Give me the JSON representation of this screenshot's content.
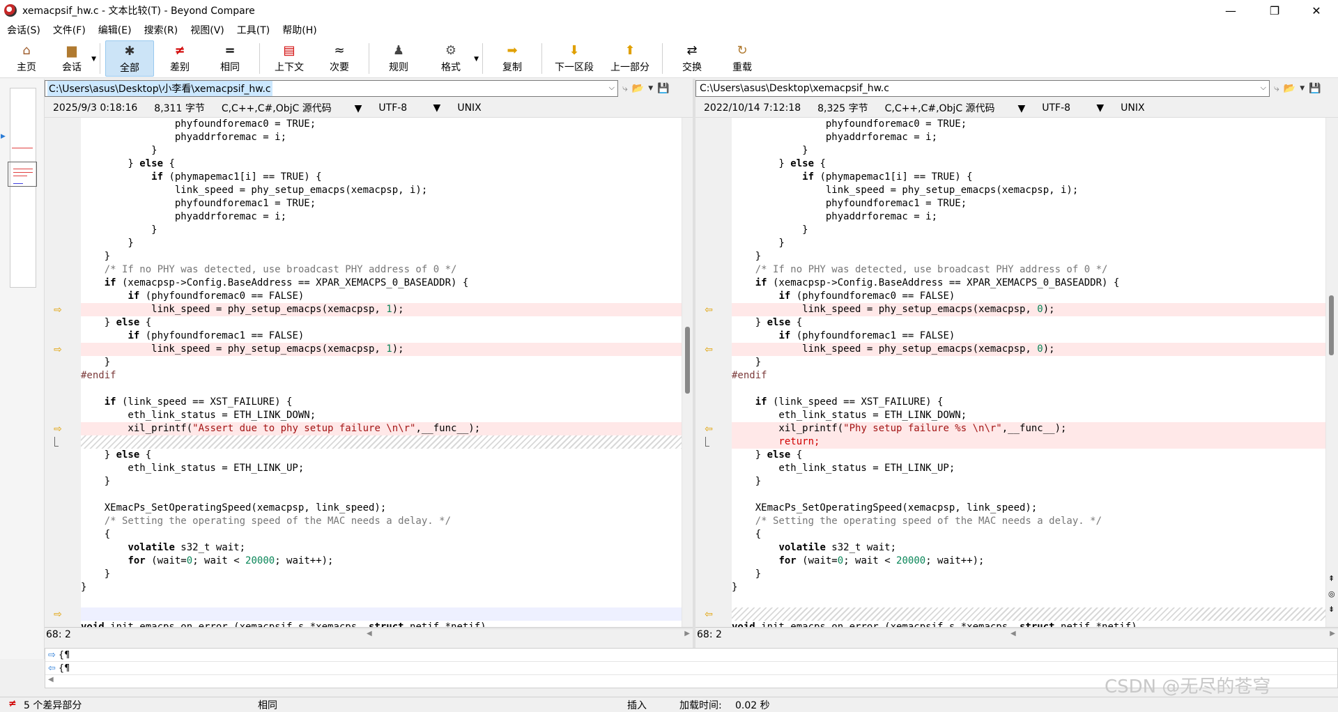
{
  "window": {
    "title": "xemacpsif_hw.c - 文本比较(T) - Beyond Compare",
    "minimize": "—",
    "maximize": "❐",
    "close": "✕"
  },
  "menu": [
    "会话(S)",
    "文件(F)",
    "编辑(E)",
    "搜索(R)",
    "视图(V)",
    "工具(T)",
    "帮助(H)"
  ],
  "toolbar": {
    "home": "主页",
    "session": "会话",
    "all": "全部",
    "diffs": "差别",
    "same": "相同",
    "context": "上下文",
    "minor": "次要",
    "rules": "规则",
    "format": "格式",
    "copy": "复制",
    "next_section": "下一区段",
    "prev_section": "上一部分",
    "swap": "交换",
    "reload": "重载"
  },
  "left": {
    "path": "C:\\Users\\asus\\Desktop\\小李看\\xemacpsif_hw.c",
    "date": "2025/9/3 0:18:16",
    "size": "8,311 字节",
    "format": "C,C++,C#,ObjC 源代码",
    "encoding": "UTF-8",
    "lineend": "UNIX",
    "position": "68: 2",
    "lines": [
      "                phyfoundforemac0 = TRUE;",
      "                phyaddrforemac = i;",
      "            }",
      "        } else {",
      "            if (phymapemac1[i] == TRUE) {",
      "                link_speed = phy_setup_emacps(xemacpsp, i);",
      "                phyfoundforemac1 = TRUE;",
      "                phyaddrforemac = i;",
      "            }",
      "        }",
      "    }",
      "    /* If no PHY was detected, use broadcast PHY address of 0 */",
      "    if (xemacpsp->Config.BaseAddress == XPAR_XEMACPS_0_BASEADDR) {",
      "        if (phyfoundforemac0 == FALSE)",
      "            link_speed = phy_setup_emacps(xemacpsp, 1);",
      "    } else {",
      "        if (phyfoundforemac1 == FALSE)",
      "            link_speed = phy_setup_emacps(xemacpsp, 1);",
      "    }",
      "#endif",
      "",
      "    if (link_speed == XST_FAILURE) {",
      "        eth_link_status = ETH_LINK_DOWN;",
      "        xil_printf(\"Assert due to phy setup failure \\n\\r\",__func__);",
      "",
      "    } else {",
      "        eth_link_status = ETH_LINK_UP;",
      "    }",
      "",
      "    XEmacPs_SetOperatingSpeed(xemacpsp, link_speed);",
      "    /* Setting the operating speed of the MAC needs a delay. */",
      "    {",
      "        volatile s32_t wait;",
      "        for (wait=0; wait < 20000; wait++);",
      "    }",
      "}",
      "",
      "",
      "void init_emacps_on_error (xemacpsif_s *xemacps, struct netif *netif)"
    ]
  },
  "right": {
    "path": "C:\\Users\\asus\\Desktop\\xemacpsif_hw.c",
    "date": "2022/10/14 7:12:18",
    "size": "8,325 字节",
    "format": "C,C++,C#,ObjC 源代码",
    "encoding": "UTF-8",
    "lineend": "UNIX",
    "position": "68: 2",
    "lines": [
      "                phyfoundforemac0 = TRUE;",
      "                phyaddrforemac = i;",
      "            }",
      "        } else {",
      "            if (phymapemac1[i] == TRUE) {",
      "                link_speed = phy_setup_emacps(xemacpsp, i);",
      "                phyfoundforemac1 = TRUE;",
      "                phyaddrforemac = i;",
      "            }",
      "        }",
      "    }",
      "    /* If no PHY was detected, use broadcast PHY address of 0 */",
      "    if (xemacpsp->Config.BaseAddress == XPAR_XEMACPS_0_BASEADDR) {",
      "        if (phyfoundforemac0 == FALSE)",
      "            link_speed = phy_setup_emacps(xemacpsp, 0);",
      "    } else {",
      "        if (phyfoundforemac1 == FALSE)",
      "            link_speed = phy_setup_emacps(xemacpsp, 0);",
      "    }",
      "#endif",
      "",
      "    if (link_speed == XST_FAILURE) {",
      "        eth_link_status = ETH_LINK_DOWN;",
      "        xil_printf(\"Phy setup failure %s \\n\\r\",__func__);",
      "        return;",
      "    } else {",
      "        eth_link_status = ETH_LINK_UP;",
      "    }",
      "",
      "    XEmacPs_SetOperatingSpeed(xemacpsp, link_speed);",
      "    /* Setting the operating speed of the MAC needs a delay. */",
      "    {",
      "        volatile s32_t wait;",
      "        for (wait=0; wait < 20000; wait++);",
      "    }",
      "}",
      "",
      "",
      "void init_emacps_on_error (xemacpsif_s *xemacps, struct netif *netif)"
    ]
  },
  "bottom_panel": {
    "row1": "{¶",
    "row2": "{¶"
  },
  "status": {
    "diff_count": "5 个差异部分",
    "same": "相同",
    "insert": "插入",
    "load_label": "加载时间:",
    "load_time": "0.02 秒"
  },
  "watermark": "CSDN @无尽的苍穹"
}
